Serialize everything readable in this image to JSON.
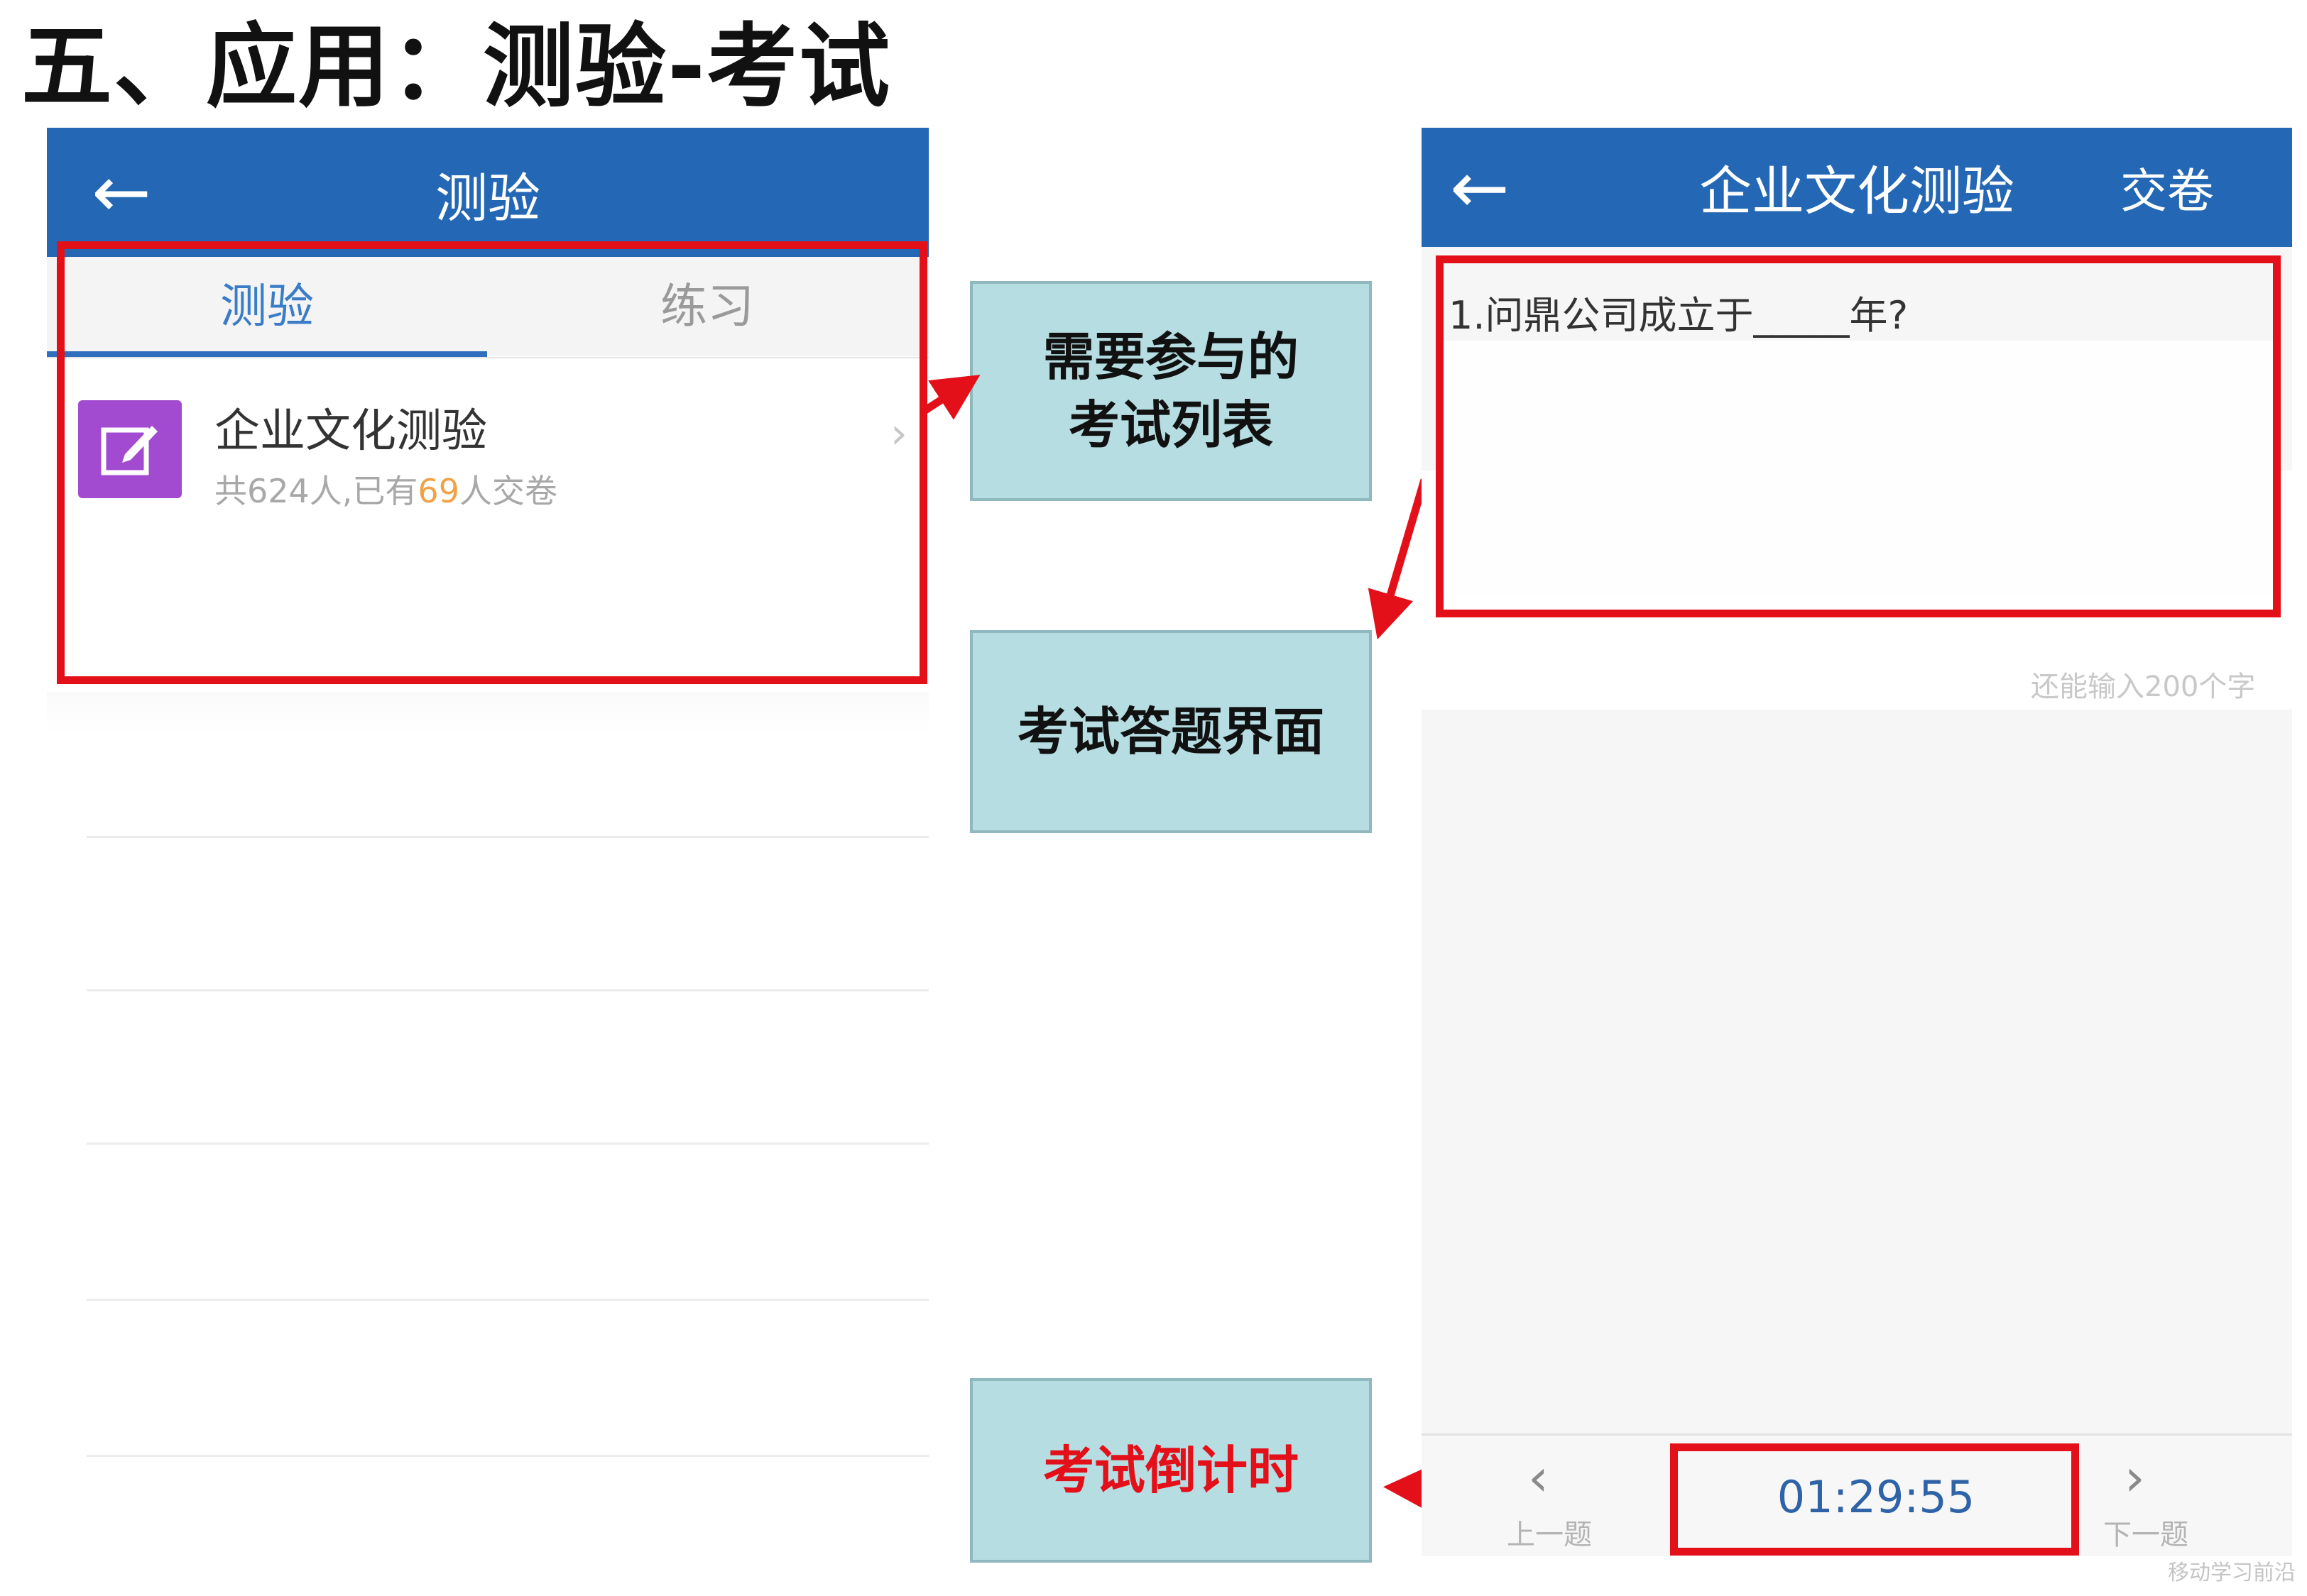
{
  "slide": {
    "title": "五、应用：测验-考试"
  },
  "left_screen": {
    "nav_back_icon": "arrow-left-icon",
    "nav_title": "测验",
    "tabs": [
      {
        "label": "测验",
        "active": true
      },
      {
        "label": "练习",
        "active": false
      }
    ],
    "exam_item": {
      "icon": "edit-icon",
      "title": "企业文化测验",
      "sub_prefix": "共624人,已有",
      "sub_count": "69",
      "sub_suffix": "人交卷",
      "chevron_icon": "chevron-right-icon"
    }
  },
  "callouts": {
    "list": "需要参与的",
    "list_line2": "考试列表",
    "answer": "考试答题界面",
    "timer": "考试倒计时"
  },
  "right_screen": {
    "nav_back_icon": "arrow-left-icon",
    "nav_title": "企业文化测验",
    "submit_label": "交卷",
    "question": "1.问鼎公司成立于_____年?",
    "char_count": "还能输入200个字",
    "prev_label": "上一题",
    "next_label": "下一题",
    "timer": "01:29:55"
  },
  "watermark": "移动学习前沿",
  "colors": {
    "nav_blue": "#2467b4",
    "highlight_red": "#e3101a",
    "callout_teal": "#b5dde2",
    "icon_purple": "#a24bd0",
    "count_orange": "#f0a247"
  }
}
